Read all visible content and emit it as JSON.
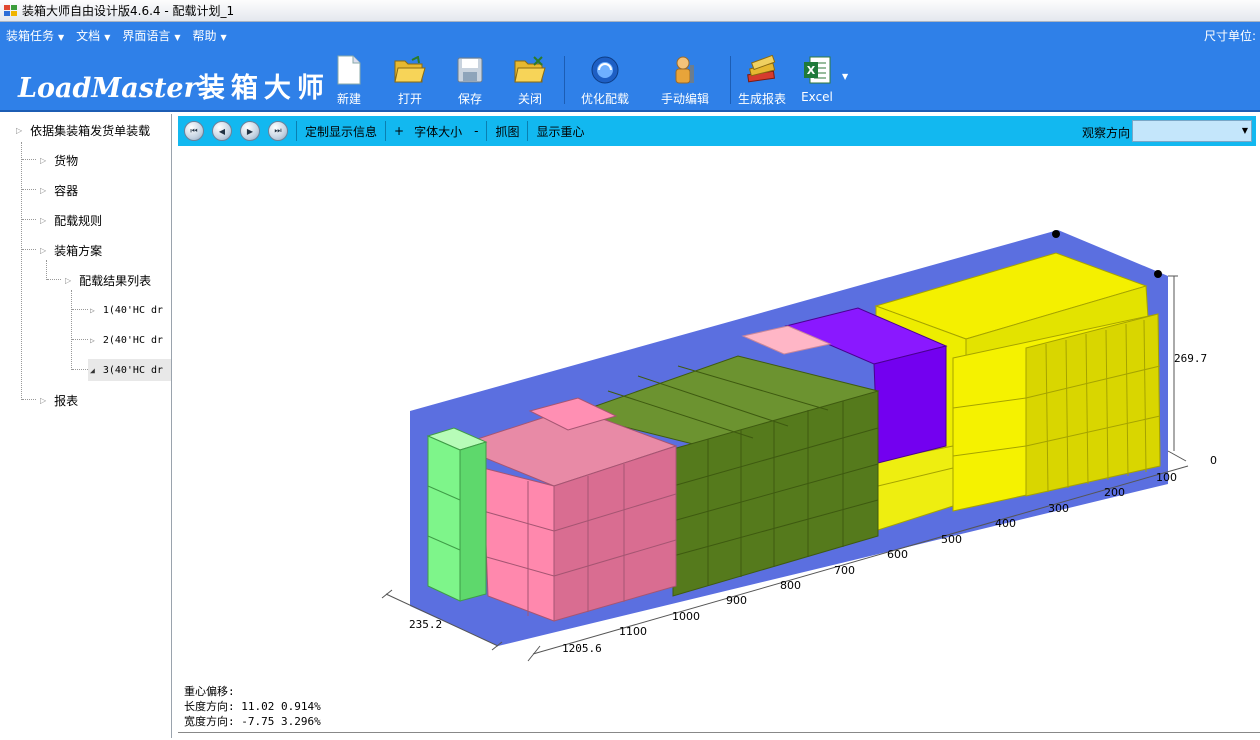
{
  "window": {
    "title": "装箱大师自由设计版4.6.4 - 配载计划_1"
  },
  "menu": {
    "items": [
      {
        "label": "装箱任务"
      },
      {
        "label": "文档"
      },
      {
        "label": "界面语言"
      },
      {
        "label": "帮助"
      }
    ],
    "right_label": "尺寸单位:"
  },
  "banner": {
    "logo_latin": "LoadMaster",
    "logo_cn": "装箱大师",
    "buttons": [
      {
        "label": "新建",
        "icon": "new-document-icon"
      },
      {
        "label": "打开",
        "icon": "open-folder-icon"
      },
      {
        "label": "保存",
        "icon": "save-disk-icon"
      },
      {
        "label": "关闭",
        "icon": "close-folder-icon"
      },
      {
        "label": "优化配载",
        "icon": "optimize-icon"
      },
      {
        "label": "手动编辑",
        "icon": "manual-edit-icon"
      },
      {
        "label": "生成报表",
        "icon": "report-books-icon"
      },
      {
        "label": "Excel",
        "icon": "excel-icon"
      }
    ]
  },
  "tree": {
    "root": "依据集装箱发货单装载",
    "nodes": [
      "货物",
      "容器",
      "配载规则",
      "装箱方案"
    ],
    "plan_child": "配载结果列表",
    "results": [
      "1(40'HC dr",
      "2(40'HC dr",
      "3(40'HC dr"
    ],
    "last": "报表"
  },
  "view_toolbar": {
    "custom_info": "定制显示信息",
    "plus": "+",
    "font_size": "字体大小",
    "minus": "-",
    "capture": "抓图",
    "show_cog": "显示重心",
    "view_direction_label": "观察方向",
    "view_direction_value": ""
  },
  "scene": {
    "height_label": "269.7",
    "height_zero": "0",
    "width_label": "235.2",
    "length_label": "1205.6",
    "length_ticks": [
      "100",
      "200",
      "300",
      "400",
      "500",
      "600",
      "700",
      "800",
      "900",
      "1000",
      "1100"
    ]
  },
  "cog": {
    "title": "重心偏移:",
    "length_line": "长度方向: 11.02  0.914%",
    "width_line": "宽度方向: -7.75  3.296%"
  },
  "colors": {
    "menu_blue": "#2f80e8",
    "toolbar_cyan": "#12b8f0",
    "container_floor": "#5b6fe0",
    "cargo_green_light": "#7ef58a",
    "cargo_pink": "#e37b9e",
    "cargo_olive": "#5f8524",
    "cargo_purple": "#7f00ff",
    "cargo_yellow": "#f2f200"
  }
}
